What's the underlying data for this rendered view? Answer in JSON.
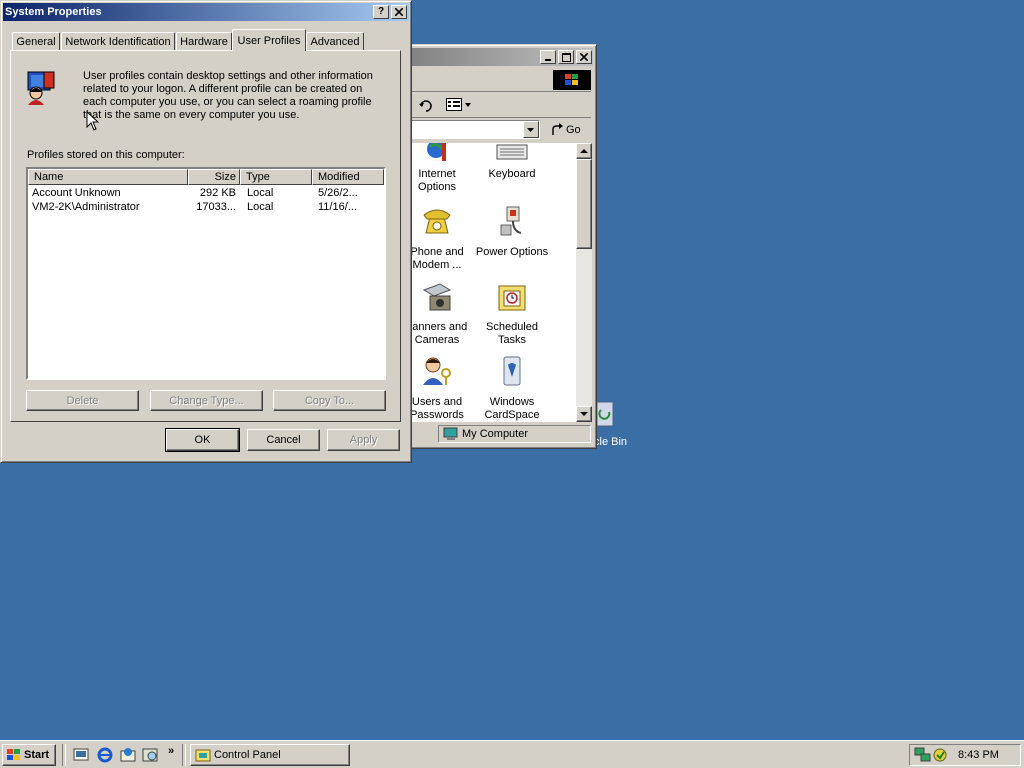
{
  "desktop": {
    "recycle_bin_label": "cle Bin"
  },
  "control_panel": {
    "go_label": "Go",
    "status_location": "My Computer",
    "icons": [
      {
        "line1": "Internet",
        "line2": "Options"
      },
      {
        "line1": "Keyboard",
        "line2": ""
      },
      {
        "line1": "Phone and",
        "line2": "Modem ..."
      },
      {
        "line1": "Power Options",
        "line2": ""
      },
      {
        "line1": "canners and",
        "line2": "Cameras"
      },
      {
        "line1": "Scheduled",
        "line2": "Tasks"
      },
      {
        "line1": "Users and",
        "line2": "Passwords"
      },
      {
        "line1": "Windows",
        "line2": "CardSpace"
      }
    ]
  },
  "system_properties": {
    "title": "System Properties",
    "help_label": "?",
    "close_label": "✕",
    "tabs": [
      "General",
      "Network Identification",
      "Hardware",
      "User Profiles",
      "Advanced"
    ],
    "selected_tab": "User Profiles",
    "description": "User profiles contain desktop settings and other information related to your logon.  A different profile can be created on each computer you use, or you can select a roaming profile that is the same on every computer you use.",
    "list_caption": "Profiles stored on this computer:",
    "columns": [
      "Name",
      "Size",
      "Type",
      "Modified"
    ],
    "rows": [
      {
        "name": "Account Unknown",
        "size": "292 KB",
        "type": "Local",
        "modified": "5/26/2..."
      },
      {
        "name": "VM2-2K\\Administrator",
        "size": "17033...",
        "type": "Local",
        "modified": "11/16/..."
      }
    ],
    "delete_label": "Delete",
    "change_type_label": "Change Type...",
    "copy_to_label": "Copy To...",
    "ok_label": "OK",
    "cancel_label": "Cancel",
    "apply_label": "Apply"
  },
  "taskbar": {
    "start_label": "Start",
    "chevron_label": "»",
    "task_label": "Control Panel",
    "clock": "8:43 PM"
  }
}
